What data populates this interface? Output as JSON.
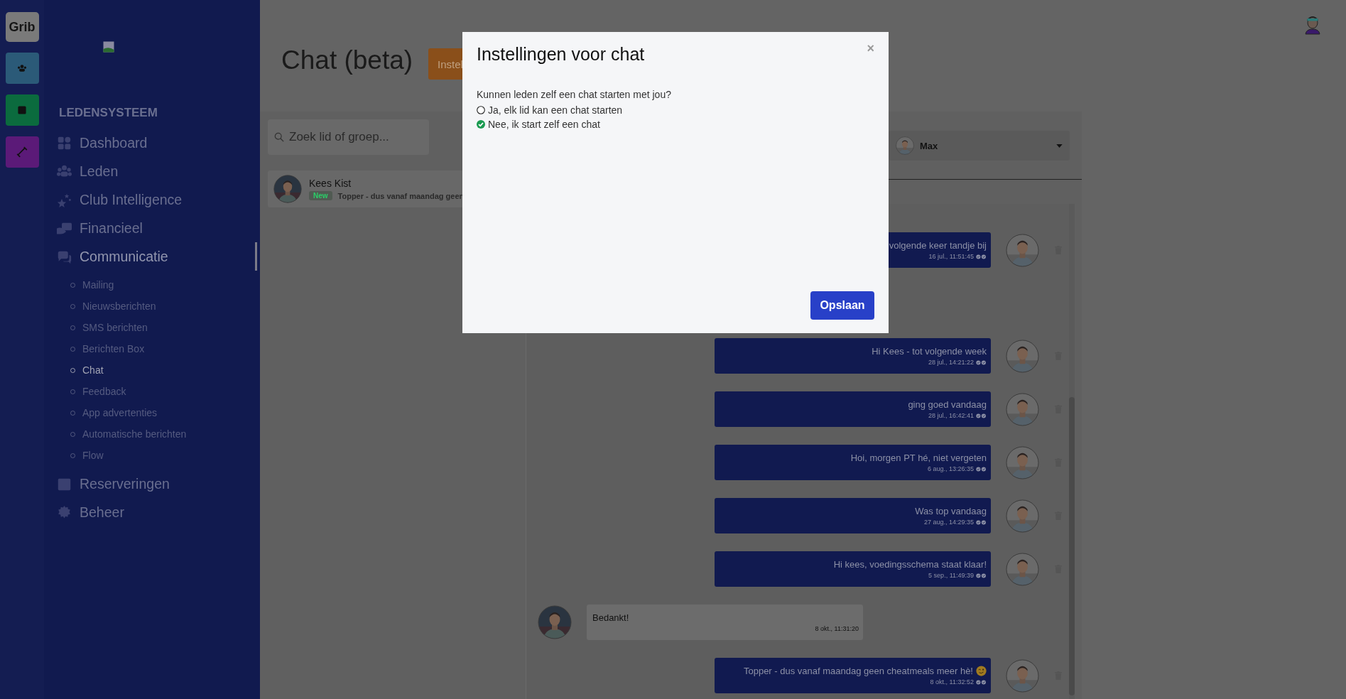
{
  "rail": {
    "brand": "Grib",
    "apps": [
      {
        "color": "#2b5a78"
      },
      {
        "color": "#0b6b3e"
      },
      {
        "color": "#5b1a78"
      }
    ]
  },
  "sidebar": {
    "section": "LEDENSYSTEEM",
    "items": [
      {
        "label": "Dashboard",
        "expanded": false
      },
      {
        "label": "Leden",
        "expanded": false
      },
      {
        "label": "Club Intelligence",
        "expanded": false
      },
      {
        "label": "Financieel",
        "expanded": false
      },
      {
        "label": "Communicatie",
        "expanded": true,
        "children": [
          {
            "label": "Mailing",
            "selected": false
          },
          {
            "label": "Nieuwsberichten",
            "selected": false
          },
          {
            "label": "SMS berichten",
            "selected": false
          },
          {
            "label": "Berichten Box",
            "selected": false
          },
          {
            "label": "Chat",
            "selected": true
          },
          {
            "label": "Feedback",
            "selected": false
          },
          {
            "label": "App advertenties",
            "selected": false
          },
          {
            "label": "Automatische berichten",
            "selected": false
          },
          {
            "label": "Flow",
            "selected": false
          }
        ]
      },
      {
        "label": "Reserveringen",
        "expanded": false
      },
      {
        "label": "Beheer",
        "expanded": false
      }
    ]
  },
  "page": {
    "title": "Chat (beta)",
    "settings_button": "Instel"
  },
  "chat": {
    "search": {
      "placeholder": "Zoek lid of groep..."
    },
    "conversations": [
      {
        "name": "Kees Kist",
        "badge": "New",
        "preview": "Topper - dus vanaf maandag geen"
      }
    ],
    "recipient": "Max",
    "messages": [
      {
        "kind": "sent",
        "text": "volgende keer tandje bij",
        "time": "16 jul., 11:51:45",
        "read": true,
        "emoji": false
      },
      {
        "kind": "sent",
        "text": "Hi Kees - tot volgende week",
        "time": "28 jul., 14:21:22",
        "read": true,
        "emoji": false
      },
      {
        "kind": "sent",
        "text": "ging goed vandaag",
        "time": "28 jul., 16:42:41",
        "read": true,
        "emoji": false
      },
      {
        "kind": "sent",
        "text": "Hoi, morgen PT hé, niet vergeten",
        "time": "6 aug., 13:26:35",
        "read": true,
        "emoji": false
      },
      {
        "kind": "sent",
        "text": "Was top vandaag",
        "time": "27 aug., 14:29:35",
        "read": true,
        "emoji": false
      },
      {
        "kind": "sent",
        "text": "Hi kees, voedingsschema staat klaar!",
        "time": "5 sep., 11:49:39",
        "read": true,
        "emoji": false
      },
      {
        "kind": "received",
        "text": "Bedankt!",
        "time": "8 okt., 11:31:20",
        "read": false,
        "emoji": false
      },
      {
        "kind": "sent",
        "text": "Topper - dus vanaf maandag geen cheatmeals meer hè!",
        "time": "8 okt., 11:32:52",
        "read": true,
        "emoji": true
      }
    ]
  },
  "modal": {
    "title": "Instellingen voor chat",
    "close": "×",
    "question": "Kunnen leden zelf een chat starten met jou?",
    "options": [
      {
        "label": "Ja, elk lid kan een chat starten",
        "selected": false
      },
      {
        "label": "Nee, ik start zelf een chat",
        "selected": true
      }
    ],
    "save_button": "Opslaan"
  }
}
